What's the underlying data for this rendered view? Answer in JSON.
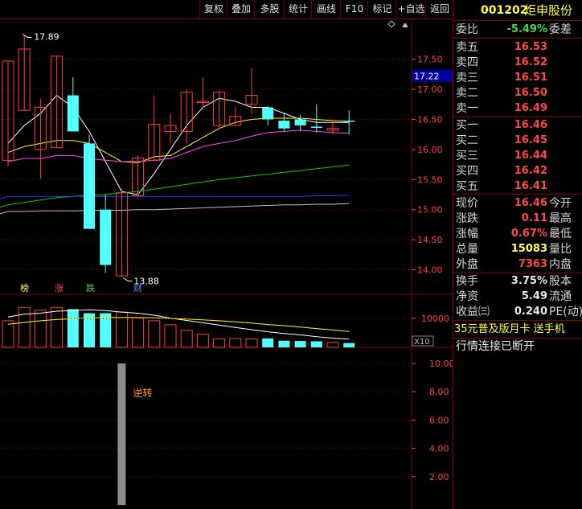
{
  "toolbar": [
    {
      "label": "复权"
    },
    {
      "label": "叠加"
    },
    {
      "label": "多股"
    },
    {
      "label": "统计"
    },
    {
      "label": "画线"
    },
    {
      "label": "F10"
    },
    {
      "label": "标记"
    },
    {
      "label": "+自选"
    },
    {
      "label": "返回"
    }
  ],
  "stock": {
    "code": "001202",
    "name": "炬申股份"
  },
  "quote": {
    "weibi": {
      "label": "委比",
      "value": "-5.49%",
      "label2": "委差"
    },
    "sell": [
      {
        "label": "卖五",
        "price": "16.53"
      },
      {
        "label": "卖四",
        "price": "16.52"
      },
      {
        "label": "卖三",
        "price": "16.51"
      },
      {
        "label": "卖二",
        "price": "16.50"
      },
      {
        "label": "卖一",
        "price": "16.49"
      }
    ],
    "buy": [
      {
        "label": "买一",
        "price": "16.46"
      },
      {
        "label": "买二",
        "price": "16.45"
      },
      {
        "label": "买三",
        "price": "16.44"
      },
      {
        "label": "买四",
        "price": "16.42"
      },
      {
        "label": "买五",
        "price": "16.41"
      }
    ],
    "stats": [
      {
        "label": "现价",
        "value": "16.46",
        "label2": "今开",
        "color": "red"
      },
      {
        "label": "涨跌",
        "value": "0.11",
        "label2": "最高",
        "color": "red"
      },
      {
        "label": "涨幅",
        "value": "0.67%",
        "label2": "最低",
        "color": "red"
      },
      {
        "label": "总量",
        "value": "15083",
        "label2": "量比",
        "color": "yellow"
      },
      {
        "label": "外盘",
        "value": "7363",
        "label2": "内盘",
        "color": "red"
      }
    ],
    "stats2": [
      {
        "label": "换手",
        "value": "3.75%",
        "label2": "股本",
        "color": "white"
      },
      {
        "label": "净资",
        "value": "5.49",
        "label2": "流通",
        "color": "white"
      },
      {
        "label": "收益㈢",
        "value": "0.240",
        "label2": "PE(动)",
        "color": "white"
      }
    ],
    "promo": "35元普及版月卡 送手机",
    "status": "行情连接已断开"
  },
  "colors": {
    "up": "#ff3c3c",
    "down": "#54ffff",
    "ma5": "#ffffff",
    "ma10": "#ffff00",
    "ma20": "#ff44ff",
    "ma60": "#00cc00",
    "ma120": "#3030ff",
    "ma250": "#c0c0c0",
    "grid": "#800000",
    "axis": "#ff4040"
  },
  "chart_data": [
    {
      "type": "candlestick",
      "price_ticks": [
        "17.50",
        "17.00",
        "16.50",
        "16.00",
        "15.50",
        "15.00",
        "14.50",
        "14.00"
      ],
      "ylim": [
        13.86,
        17.95
      ],
      "current_price_label": "17.22",
      "high_annotation": "17.89",
      "low_annotation": "13.88",
      "markers": [
        {
          "text": "榜"
        },
        {
          "text": "涨"
        },
        {
          "text": "跌"
        },
        {
          "text": "财"
        }
      ],
      "candles": [
        {
          "o": 15.82,
          "h": 16.95,
          "l": 15.72,
          "c": 17.47
        },
        {
          "o": 16.65,
          "h": 17.89,
          "l": 16.65,
          "c": 17.67
        },
        {
          "o": 16.0,
          "h": 16.84,
          "l": 15.51,
          "c": 16.7
        },
        {
          "o": 16.03,
          "h": 17.56,
          "l": 16.03,
          "c": 17.55
        },
        {
          "o": 16.9,
          "h": 17.2,
          "l": 16.3,
          "c": 16.3
        },
        {
          "o": 16.1,
          "h": 16.25,
          "l": 15.4,
          "c": 14.68
        },
        {
          "o": 15.0,
          "h": 15.25,
          "l": 13.95,
          "c": 14.08
        },
        {
          "o": 13.9,
          "h": 15.35,
          "l": 13.88,
          "c": 15.28
        },
        {
          "o": 15.23,
          "h": 15.9,
          "l": 15.2,
          "c": 15.86
        },
        {
          "o": 15.82,
          "h": 16.9,
          "l": 15.8,
          "c": 16.42
        },
        {
          "o": 16.3,
          "h": 16.6,
          "l": 16.1,
          "c": 16.4
        },
        {
          "o": 16.3,
          "h": 17.0,
          "l": 16.1,
          "c": 16.95
        },
        {
          "o": 16.8,
          "h": 17.2,
          "l": 16.7,
          "c": 16.8
        },
        {
          "o": 16.4,
          "h": 16.98,
          "l": 16.35,
          "c": 16.95
        },
        {
          "o": 16.4,
          "h": 16.7,
          "l": 16.4,
          "c": 16.55
        },
        {
          "o": 16.75,
          "h": 17.35,
          "l": 16.6,
          "c": 16.9
        },
        {
          "o": 16.7,
          "h": 16.72,
          "l": 16.4,
          "c": 16.5
        },
        {
          "o": 16.48,
          "h": 16.6,
          "l": 16.3,
          "c": 16.35
        },
        {
          "o": 16.5,
          "h": 16.58,
          "l": 16.3,
          "c": 16.4
        },
        {
          "o": 16.38,
          "h": 16.75,
          "l": 16.28,
          "c": 16.36
        },
        {
          "o": 16.32,
          "h": 16.5,
          "l": 16.25,
          "c": 16.35
        },
        {
          "o": 16.48,
          "h": 16.65,
          "l": 16.25,
          "c": 16.46
        }
      ],
      "ma": {
        "ma5": [
          16.1,
          16.4,
          16.6,
          16.9,
          16.7,
          16.3,
          15.8,
          15.3,
          15.25,
          15.6,
          16.0,
          16.4,
          16.7,
          16.85,
          16.8,
          16.7,
          16.7,
          16.6,
          16.5,
          16.45,
          16.45,
          16.45
        ],
        "ma10": [
          15.95,
          16.05,
          16.1,
          16.15,
          16.15,
          16.1,
          15.95,
          15.8,
          15.78,
          15.88,
          15.9,
          16.05,
          16.2,
          16.35,
          16.45,
          16.5,
          16.52,
          16.52,
          16.52,
          16.5,
          16.48,
          16.47
        ],
        "ma20": [
          15.8,
          15.85,
          15.85,
          15.9,
          15.9,
          15.85,
          15.82,
          15.8,
          15.8,
          15.82,
          15.85,
          15.95,
          16.05,
          16.1,
          16.15,
          16.22,
          16.28,
          16.3,
          16.32,
          16.3,
          16.28,
          16.27
        ],
        "ma60": [
          15.08,
          15.12,
          15.16,
          15.2,
          15.22,
          15.24,
          15.25,
          15.28,
          15.3,
          15.34,
          15.38,
          15.42,
          15.46,
          15.5,
          15.53,
          15.56,
          15.59,
          15.62,
          15.65,
          15.68,
          15.71,
          15.74
        ],
        "ma120": [
          15.22,
          15.22,
          15.22,
          15.22,
          15.22,
          15.22,
          15.22,
          15.22,
          15.22,
          15.22,
          15.22,
          15.22,
          15.22,
          15.22,
          15.22,
          15.22,
          15.22,
          15.22,
          15.22,
          15.23,
          15.23,
          15.24
        ],
        "ma250": [
          14.97,
          14.97,
          14.98,
          14.98,
          14.98,
          14.99,
          14.99,
          14.99,
          15.0,
          15.0,
          15.01,
          15.02,
          15.03,
          15.04,
          15.05,
          15.06,
          15.07,
          15.08,
          15.08,
          15.09,
          15.09,
          15.1
        ]
      }
    },
    {
      "type": "bar",
      "title": "volume",
      "tick_label": "10000",
      "scale_label": "X10",
      "ylim": [
        0,
        15000
      ],
      "values": [
        9200,
        13800,
        12800,
        13800,
        13200,
        11800,
        11800,
        12200,
        10200,
        9200,
        7800,
        5900,
        4500,
        3000,
        3100,
        2900,
        3100,
        2300,
        2200,
        2100,
        1700,
        1500
      ],
      "ma_lines": {
        "a": [
          10500,
          11500,
          11800,
          12500,
          12700,
          13000,
          12700,
          12200,
          11800,
          11100,
          10100,
          9300,
          8500,
          7700,
          6900,
          6100,
          5400,
          4800,
          4300,
          3700,
          3200,
          2800
        ],
        "b": [
          8000,
          8600,
          9200,
          9600,
          9900,
          10200,
          10300,
          10300,
          10300,
          10200,
          10000,
          9800,
          9500,
          9200,
          8800,
          8400,
          7900,
          7500,
          7000,
          6500,
          6000,
          5500
        ]
      }
    },
    {
      "type": "bar",
      "title": "indicator",
      "ticks": [
        "10.00",
        "8.00",
        "6.00",
        "4.00",
        "2.00"
      ],
      "ylim": [
        0,
        10.85
      ],
      "label": "逆转",
      "bars": [
        {
          "index": 7,
          "value": 10.0
        }
      ]
    }
  ]
}
